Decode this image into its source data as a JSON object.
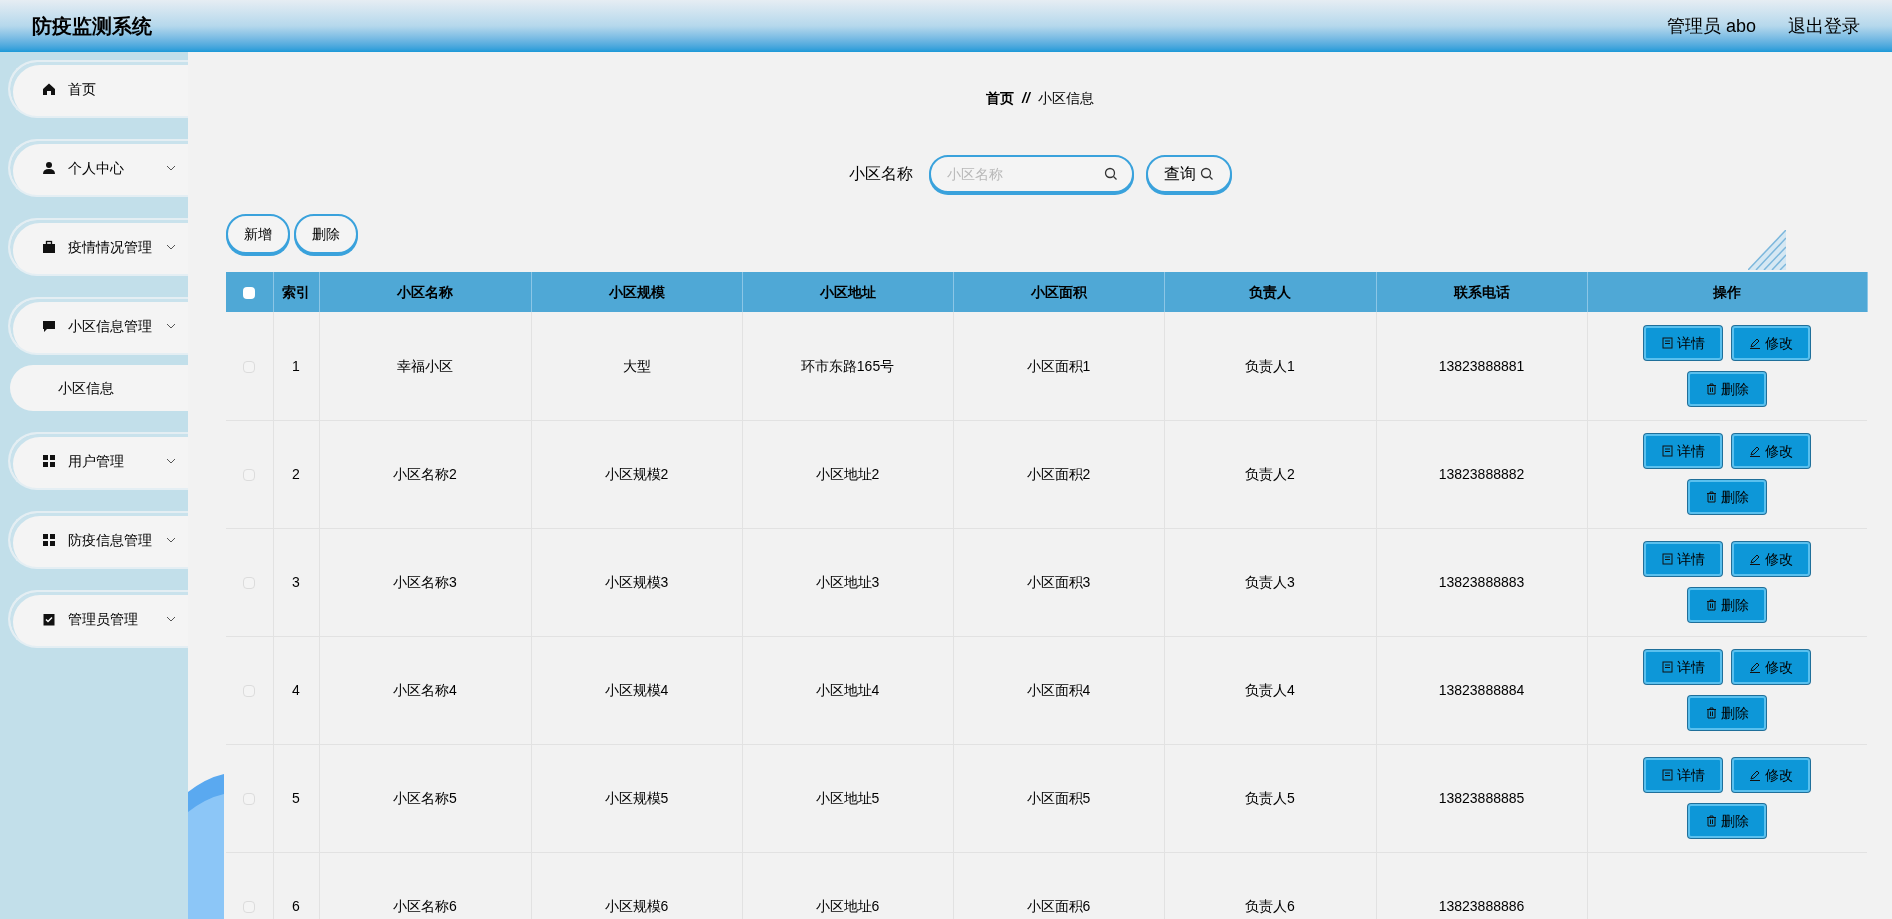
{
  "header": {
    "title": "防疫监测系统",
    "user": "管理员 abo",
    "logout": "退出登录"
  },
  "sidebar": {
    "items": [
      {
        "label": "首页",
        "expandable": false
      },
      {
        "label": "个人中心",
        "expandable": true
      },
      {
        "label": "疫情情况管理",
        "expandable": true
      },
      {
        "label": "小区信息管理",
        "expandable": true,
        "children": [
          {
            "label": "小区信息"
          }
        ]
      },
      {
        "label": "用户管理",
        "expandable": true
      },
      {
        "label": "防疫信息管理",
        "expandable": true
      },
      {
        "label": "管理员管理",
        "expandable": true
      }
    ]
  },
  "breadcrumb": [
    "首页",
    "//",
    "小区信息"
  ],
  "search": {
    "label": "小区名称",
    "placeholder": "小区名称",
    "button": "查询"
  },
  "toolbar": [
    "新增",
    "删除"
  ],
  "table": {
    "select_all_checked": false,
    "columns": [
      "索引",
      "小区名称",
      "小区规模",
      "小区地址",
      "小区面积",
      "负责人",
      "联系电话",
      "操作"
    ],
    "rows": [
      {
        "checked": false,
        "cells": [
          "1",
          "幸福小区",
          "大型",
          "环市东路165号",
          "小区面积1",
          "负责人1",
          "13823888881"
        ],
        "actions": [
          "详情",
          "修改",
          "删除"
        ]
      },
      {
        "checked": false,
        "cells": [
          "2",
          "小区名称2",
          "小区规模2",
          "小区地址2",
          "小区面积2",
          "负责人2",
          "13823888882"
        ],
        "actions": [
          "详情",
          "修改",
          "删除"
        ]
      },
      {
        "checked": false,
        "cells": [
          "3",
          "小区名称3",
          "小区规模3",
          "小区地址3",
          "小区面积3",
          "负责人3",
          "13823888883"
        ],
        "actions": [
          "详情",
          "修改",
          "删除"
        ]
      },
      {
        "checked": false,
        "cells": [
          "4",
          "小区名称4",
          "小区规模4",
          "小区地址4",
          "小区面积4",
          "负责人4",
          "13823888884"
        ],
        "actions": [
          "详情",
          "修改",
          "删除"
        ]
      },
      {
        "checked": false,
        "cells": [
          "5",
          "小区名称5",
          "小区规模5",
          "小区地址5",
          "小区面积5",
          "负责人5",
          "13823888885"
        ],
        "actions": [
          "详情",
          "修改",
          "删除"
        ]
      },
      {
        "checked": false,
        "cells": [
          "6",
          "小区名称6",
          "小区规模6",
          "小区地址6",
          "小区面积6",
          "负责人6",
          "13823888886"
        ],
        "actions": []
      }
    ]
  }
}
